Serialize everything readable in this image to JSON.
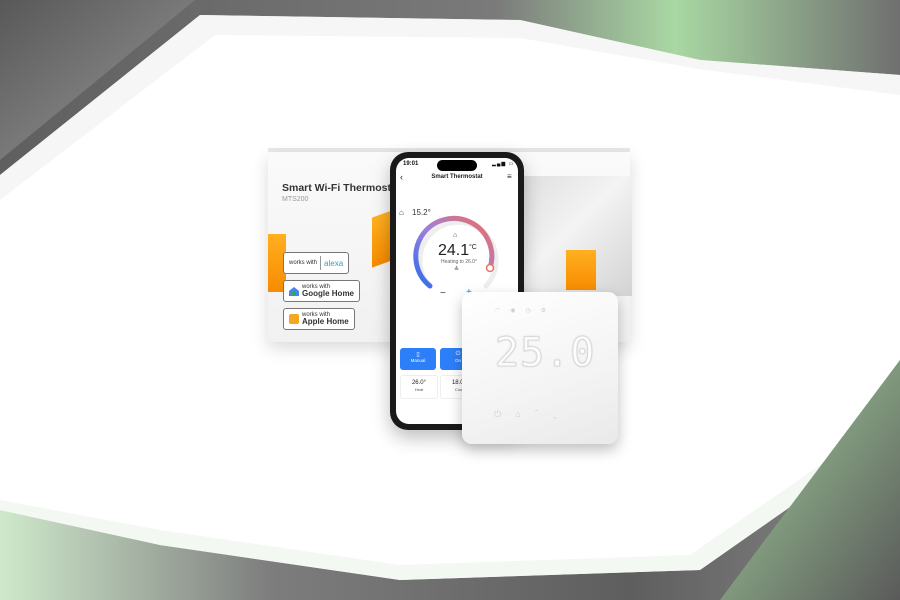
{
  "colors": {
    "frame_dark": "#6e6e6e",
    "frame_green": "#9fd49c",
    "orange_accent": "#f78b00",
    "app_blue": "#2d7ff9"
  },
  "box": {
    "title": "Smart Wi-Fi Thermostat",
    "model": "MTS200",
    "badges": [
      {
        "small": "works with",
        "brand": "alexa",
        "icon": "alexa-icon"
      },
      {
        "small": "works with",
        "brand": "Google Home",
        "icon": "google-home-icon"
      },
      {
        "small": "works with",
        "brand": "Apple Home",
        "icon": "apple-home-icon"
      }
    ]
  },
  "phone": {
    "status_time": "19:01",
    "app_title": "Smart Thermostat",
    "room_temp": "15.2°",
    "current_temp": "24.1",
    "temp_unit": "°C",
    "heating_text": "Heating to 26.0°",
    "mode_buttons": [
      {
        "label": "Manual",
        "icon": "manual-icon"
      },
      {
        "label": "On",
        "icon": "power-icon"
      }
    ],
    "presets": [
      {
        "value": "26.0°",
        "label": "Heat"
      },
      {
        "value": "18.0°",
        "label": "Cool"
      }
    ]
  },
  "device": {
    "display": "25.0",
    "icons": [
      "wifi-icon",
      "heat-icon",
      "schedule-icon",
      "settings-icon"
    ],
    "buttons": [
      "power-icon",
      "mode-icon",
      "up-icon",
      "down-icon"
    ]
  }
}
